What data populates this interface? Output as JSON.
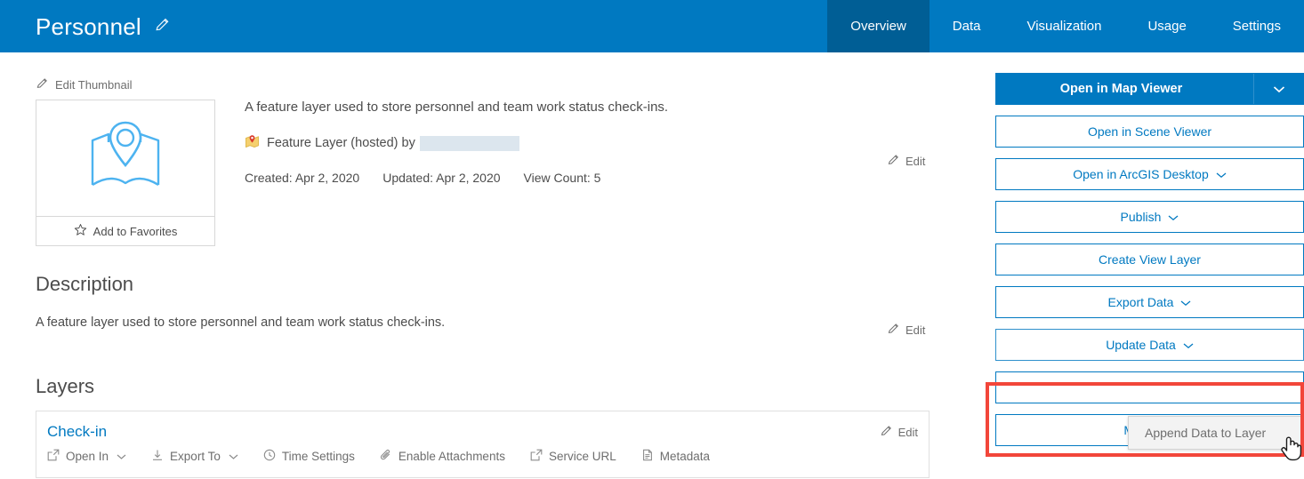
{
  "header": {
    "title": "Personnel",
    "edit_title_icon": "pencil-icon",
    "tabs": [
      {
        "label": "Overview",
        "active": true
      },
      {
        "label": "Data",
        "active": false
      },
      {
        "label": "Visualization",
        "active": false
      },
      {
        "label": "Usage",
        "active": false
      },
      {
        "label": "Settings",
        "active": false
      }
    ],
    "colors": {
      "banner": "#0079c1",
      "active_tab": "#005e95"
    }
  },
  "thumbnail": {
    "edit_label": "Edit Thumbnail",
    "edit_icon": "pencil-icon",
    "image_icon": "map-pin-thumbnail-icon",
    "favorite_label": "Add to Favorites",
    "favorite_icon": "star-icon"
  },
  "item": {
    "summary": "A feature layer used to store personnel and team work status check-ins.",
    "type_icon": "feature-layer-icon",
    "type_text": "Feature Layer (hosted) by",
    "owner": "",
    "created_label": "Created: Apr 2, 2020",
    "updated_label": "Updated: Apr 2, 2020",
    "view_count_label": "View Count: 5",
    "edit_label": "Edit"
  },
  "description": {
    "heading": "Description",
    "text": "A feature layer used to store personnel and team work status check-ins.",
    "edit_label": "Edit"
  },
  "layers": {
    "heading": "Layers",
    "card": {
      "name": "Check-in",
      "edit_label": "Edit",
      "actions": [
        {
          "label": "Open In",
          "icon": "external-link-icon",
          "caret": true
        },
        {
          "label": "Export To",
          "icon": "download-icon",
          "caret": true
        },
        {
          "label": "Time Settings",
          "icon": "clock-icon",
          "caret": false
        },
        {
          "label": "Enable Attachments",
          "icon": "paperclip-icon",
          "caret": false
        },
        {
          "label": "Service URL",
          "icon": "external-link-icon",
          "caret": false
        },
        {
          "label": "Metadata",
          "icon": "document-icon",
          "caret": false
        }
      ]
    }
  },
  "rail": {
    "buttons": [
      {
        "label": "Open in Map Viewer",
        "style": "primary",
        "caret": true,
        "split": true
      },
      {
        "label": "Open in Scene Viewer",
        "style": "outline",
        "caret": false
      },
      {
        "label": "Open in ArcGIS Desktop",
        "style": "outline",
        "caret": true
      },
      {
        "label": "Publish",
        "style": "outline",
        "caret": true
      },
      {
        "label": "Create View Layer",
        "style": "outline",
        "caret": false
      },
      {
        "label": "Export Data",
        "style": "outline",
        "caret": true
      },
      {
        "label": "Update Data",
        "style": "outline",
        "caret": true
      },
      {
        "label": "",
        "style": "outline",
        "caret": false
      },
      {
        "label": "Metadata",
        "style": "outline",
        "caret": false
      }
    ]
  },
  "dropdown": {
    "open": true,
    "items": [
      "Append Data to Layer"
    ],
    "item_0": "Append Data to Layer"
  },
  "annotation": {
    "highlight_color": "#f2463a",
    "cursor": "pointer-hand-cursor"
  }
}
